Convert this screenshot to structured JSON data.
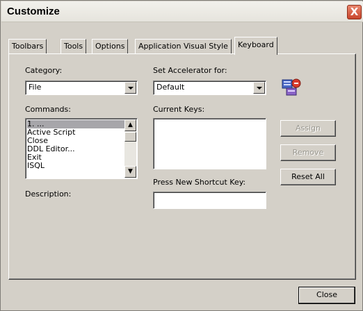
{
  "window": {
    "title": "Customize",
    "close_glyph": "X"
  },
  "tabs": [
    {
      "label": "Toolbars"
    },
    {
      "label": "Tools"
    },
    {
      "label": "Options"
    },
    {
      "label": "Application Visual Style"
    },
    {
      "label": "Keyboard",
      "active": true
    }
  ],
  "keyboard": {
    "category_label": "Category:",
    "category_value": "File",
    "set_accel_label": "Set Accelerator for:",
    "set_accel_value": "Default",
    "commands_label": "Commands:",
    "commands": [
      {
        "label": "1. ...",
        "selected": true
      },
      {
        "label": "Active Script"
      },
      {
        "label": "Close"
      },
      {
        "label": "DDL Editor..."
      },
      {
        "label": "Exit"
      },
      {
        "label": "ISQL"
      }
    ],
    "current_keys_label": "Current Keys:",
    "new_shortcut_label": "Press New Shortcut Key:",
    "new_shortcut_value": "",
    "description_label": "Description:",
    "assign_label": "Assign",
    "remove_label": "Remove",
    "reset_all_label": "Reset All"
  },
  "footer": {
    "close_label": "Close"
  },
  "icons": {
    "toolbar_image": "keyboard-shortcut-icon",
    "scroll_up": "chevron-up-icon",
    "scroll_down": "chevron-down-icon"
  },
  "colors": {
    "close_button": "#d25a3f",
    "selection": "#a7a6aa",
    "dialog_bg": "#d4d0c8"
  }
}
